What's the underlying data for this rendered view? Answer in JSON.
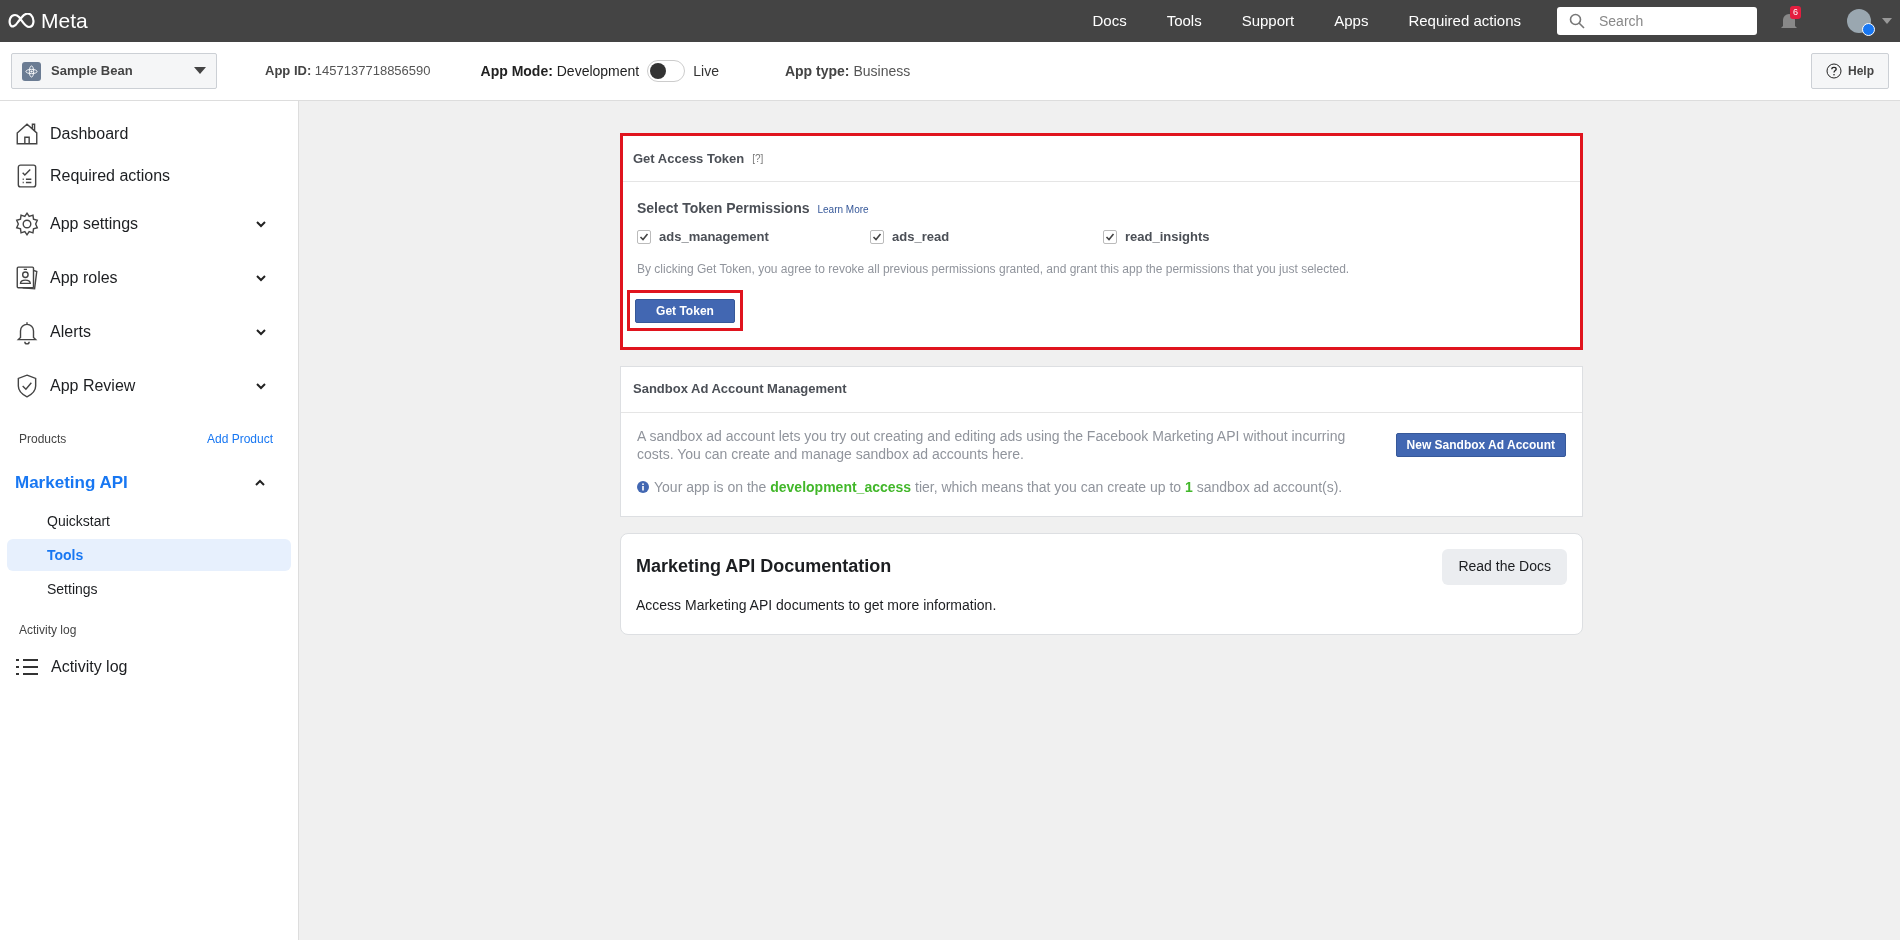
{
  "topbar": {
    "logo": "Meta",
    "nav": [
      "Docs",
      "Tools",
      "Support",
      "Apps",
      "Required actions"
    ],
    "search": {
      "placeholder": "Search"
    },
    "notifications": "6"
  },
  "subheader": {
    "app_name": "Sample Bean",
    "app_id_label": "App ID:",
    "app_id": "1457137718856590",
    "mode_label": "App Mode:",
    "mode_value": "Development",
    "mode_live": false,
    "live_label": "Live",
    "type_label": "App type:",
    "type_value": "Business",
    "help": "Help"
  },
  "sidebar": {
    "items": [
      {
        "kind": "home",
        "label": "Dashboard"
      },
      {
        "kind": "checklist",
        "label": "Required actions"
      },
      {
        "kind": "gear",
        "label": "App settings",
        "expanded": false
      },
      {
        "kind": "badge",
        "label": "App roles",
        "expanded": false
      },
      {
        "kind": "bell",
        "label": "Alerts",
        "expanded": false
      },
      {
        "kind": "shield",
        "label": "App Review",
        "expanded": false
      }
    ],
    "products_label": "Products",
    "add_product": "Add Product",
    "product": {
      "label": "Marketing API",
      "expanded": true,
      "children": [
        {
          "label": "Quickstart",
          "selected": false
        },
        {
          "label": "Tools",
          "selected": true
        },
        {
          "label": "Settings",
          "selected": false
        }
      ]
    },
    "activity_section": "Activity log",
    "activity_item": "Activity log"
  },
  "token_card": {
    "title": "Get Access Token",
    "help": "[?]",
    "highlighted": true,
    "permissions_title": "Select Token Permissions",
    "learn_more": "Learn More",
    "permissions": [
      {
        "label": "ads_management",
        "checked": true
      },
      {
        "label": "ads_read",
        "checked": true
      },
      {
        "label": "read_insights",
        "checked": true
      }
    ],
    "disclaimer": "By clicking Get Token, you agree to revoke all previous permissions granted, and grant this app the permissions that you just selected.",
    "button": {
      "label": "Get Token",
      "highlighted": true
    }
  },
  "sandbox_card": {
    "title": "Sandbox Ad Account Management",
    "description": "A sandbox ad account lets you try out creating and editing ads using the Facebook Marketing API without incurring costs. You can create and manage sandbox ad accounts here.",
    "button": "New Sandbox Ad Account",
    "tier_note": "Your app is on the **development_access** tier, which means that you can create up to **1** sandbox ad account(s)."
  },
  "docs_card": {
    "title": "Marketing API Documentation",
    "button": "Read the Docs",
    "description": "Access Marketing API documents to get more information."
  }
}
